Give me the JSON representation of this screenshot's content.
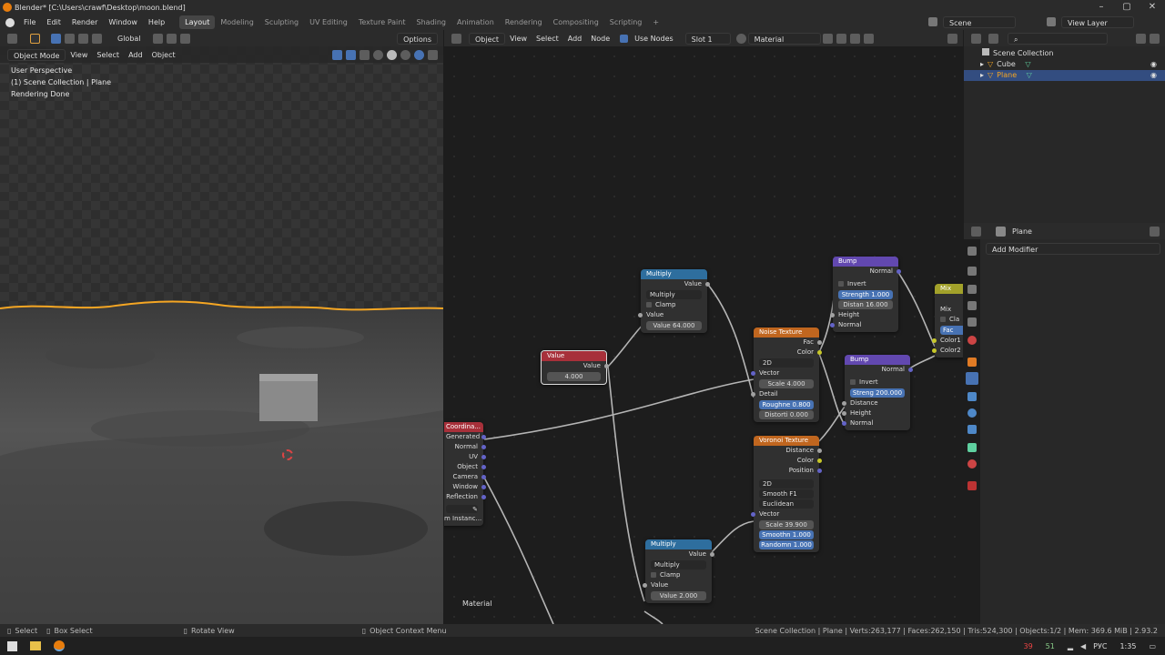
{
  "window": {
    "title": "Blender* [C:\\Users\\crawf\\Desktop\\moon.blend]"
  },
  "menus": [
    "File",
    "Edit",
    "Render",
    "Window",
    "Help"
  ],
  "workspaces": [
    "Layout",
    "Modeling",
    "Sculpting",
    "UV Editing",
    "Texture Paint",
    "Shading",
    "Animation",
    "Rendering",
    "Compositing",
    "Scripting",
    "+"
  ],
  "scene": {
    "name": "Scene",
    "view_layer": "View Layer"
  },
  "toolbar": {
    "transform_orientation": "Global",
    "options": "Options"
  },
  "viewport": {
    "mode": "Object Mode",
    "menus": [
      "View",
      "Select",
      "Add",
      "Object"
    ],
    "info": [
      "User Perspective",
      "(1) Scene Collection | Plane",
      "Rendering Done"
    ]
  },
  "node_editor": {
    "type": "Object",
    "menus": [
      "View",
      "Select",
      "Add",
      "Node"
    ],
    "use_nodes": "Use Nodes",
    "slot": "Slot 1",
    "material": "Material",
    "frame_label": "Material"
  },
  "nodes": {
    "multiply1": {
      "title": "Multiply",
      "out": "Value",
      "op": "Multiply",
      "clamp": "Clamp",
      "in": "Value",
      "value_field": "Value   64.000"
    },
    "value": {
      "title": "Value",
      "out": "Value",
      "field": "4.000"
    },
    "noise": {
      "title": "Noise Texture",
      "fac": "Fac",
      "color": "Color",
      "dim": "2D",
      "vector": "Vector",
      "scale": "Scale   4.000",
      "detail": "Detail",
      "rough": "Roughne   0.800",
      "distort": "Distorti   0.000"
    },
    "bump1": {
      "title": "Bump",
      "normal_out": "Normal",
      "invert": "Invert",
      "strength": "Strength   1.000",
      "distance": "Distan   16.000",
      "height": "Height",
      "normal_in": "Normal"
    },
    "bump2": {
      "title": "Bump",
      "normal_out": "Normal",
      "invert": "Invert",
      "strength": "Streng   200.000",
      "distance": "Distance",
      "height": "Height",
      "normal_in": "Normal"
    },
    "mix": {
      "title": "Mix",
      "mix": "Mix",
      "clamp": "Cla",
      "fac": "Fac",
      "color1": "Color1",
      "color2": "Color2"
    },
    "coord": {
      "title": "Coordina...",
      "outs": [
        "Generated",
        "Normal",
        "UV",
        "Object",
        "Camera",
        "Window",
        "Reflection"
      ],
      "instancer": "m Instanc..."
    },
    "voronoi": {
      "title": "Voronoi Texture",
      "outs": [
        "Distance",
        "Color",
        "Position"
      ],
      "dim": "2D",
      "feature": "Smooth F1",
      "metric": "Euclidean",
      "vector": "Vector",
      "scale": "Scale   39.900",
      "smooth": "Smoothn   1.000",
      "random": "Randomn   1.000"
    },
    "multiply2": {
      "title": "Multiply",
      "out": "Value",
      "op": "Multiply",
      "clamp": "Clamp",
      "in": "Value",
      "value_field": "Value   2.000"
    }
  },
  "outliner": {
    "root": "Scene Collection",
    "items": [
      {
        "name": "Cube",
        "selected": false
      },
      {
        "name": "Plane",
        "selected": true
      }
    ]
  },
  "properties": {
    "object": "Plane",
    "add_modifier": "Add Modifier"
  },
  "statusbar": {
    "select": "Select",
    "box_select": "Box Select",
    "rotate": "Rotate View",
    "context_menu": "Object Context Menu",
    "stats": "Scene Collection | Plane | Verts:263,177 | Faces:262,150 | Tris:524,300 | Objects:1/2 | Mem: 369.6 MiB | 2.93.2"
  },
  "taskbar": {
    "lang": "РУС",
    "time": "1:35",
    "badge1": "39",
    "badge2": "51"
  },
  "colors": {
    "accent": "#4772b3",
    "selected_orange": "#f5a623",
    "math_header": "#2e6e9e",
    "input_header": "#a7303a",
    "texture_header": "#c0661f",
    "vector_header": "#6248b0",
    "color_header": "#a2a12a"
  }
}
